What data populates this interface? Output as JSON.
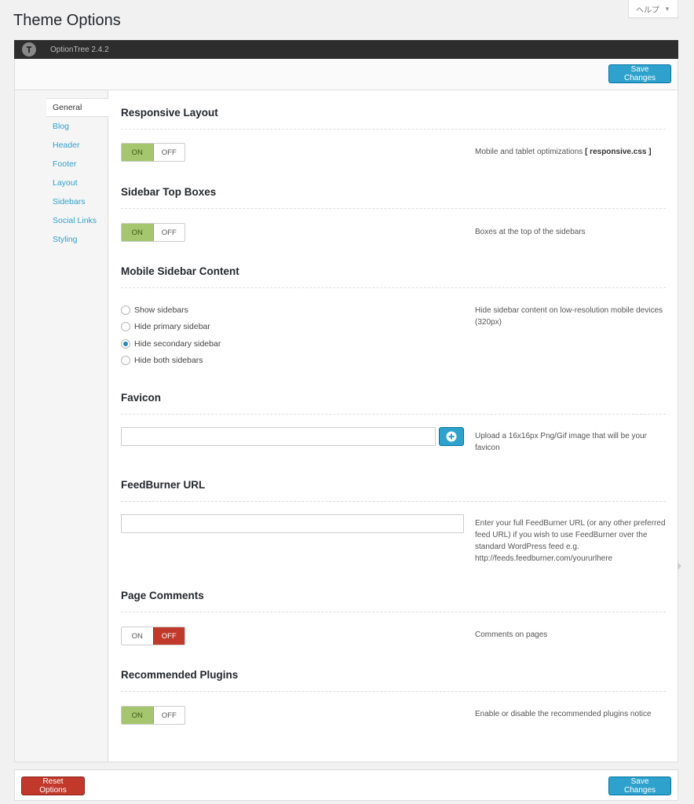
{
  "page": {
    "title": "Theme Options"
  },
  "help": {
    "label": "ヘルプ"
  },
  "optiontree": {
    "version": "OptionTree 2.4.2"
  },
  "toolbar": {
    "save_label": "Save Changes"
  },
  "nav": {
    "items": [
      {
        "label": "General",
        "active": true
      },
      {
        "label": "Blog"
      },
      {
        "label": "Header"
      },
      {
        "label": "Footer"
      },
      {
        "label": "Layout"
      },
      {
        "label": "Sidebars"
      },
      {
        "label": "Social Links"
      },
      {
        "label": "Styling"
      }
    ]
  },
  "sections": {
    "responsive": {
      "title": "Responsive Layout",
      "on": "ON",
      "off": "OFF",
      "state": "on",
      "desc_prefix": "Mobile and tablet optimizations ",
      "desc_bold": "[ responsive.css ]"
    },
    "sidebar_top": {
      "title": "Sidebar Top Boxes",
      "on": "ON",
      "off": "OFF",
      "state": "on",
      "desc": "Boxes at the top of the sidebars"
    },
    "mobile_sidebar": {
      "title": "Mobile Sidebar Content",
      "options": [
        {
          "label": "Show sidebars",
          "checked": false
        },
        {
          "label": "Hide primary sidebar",
          "checked": false
        },
        {
          "label": "Hide secondary sidebar",
          "checked": true
        },
        {
          "label": "Hide both sidebars",
          "checked": false
        }
      ],
      "desc": "Hide sidebar content on low-resolution mobile devices (320px)"
    },
    "favicon": {
      "title": "Favicon",
      "value": "",
      "desc": "Upload a 16x16px Png/Gif image that will be your favicon"
    },
    "feedburner": {
      "title": "FeedBurner URL",
      "value": "",
      "desc": "Enter your full FeedBurner URL (or any other preferred feed URL) if you wish to use FeedBurner over the standard WordPress feed e.g. http://feeds.feedburner.com/yoururlhere"
    },
    "page_comments": {
      "title": "Page Comments",
      "on": "ON",
      "off": "OFF",
      "state": "off",
      "desc": "Comments on pages"
    },
    "recommended_plugins": {
      "title": "Recommended Plugins",
      "on": "ON",
      "off": "OFF",
      "state": "on",
      "desc": "Enable or disable the recommended plugins notice"
    }
  },
  "footer": {
    "reset_label": "Reset Options",
    "save_label": "Save Changes"
  },
  "colors": {
    "accent": "#2ea2cc",
    "on_green": "#a5c66e",
    "off_red": "#c0392b"
  },
  "icons": {
    "logo": "optiontree-logo-icon",
    "upload": "plus-circle-icon",
    "help_caret": "caret-down-icon"
  }
}
